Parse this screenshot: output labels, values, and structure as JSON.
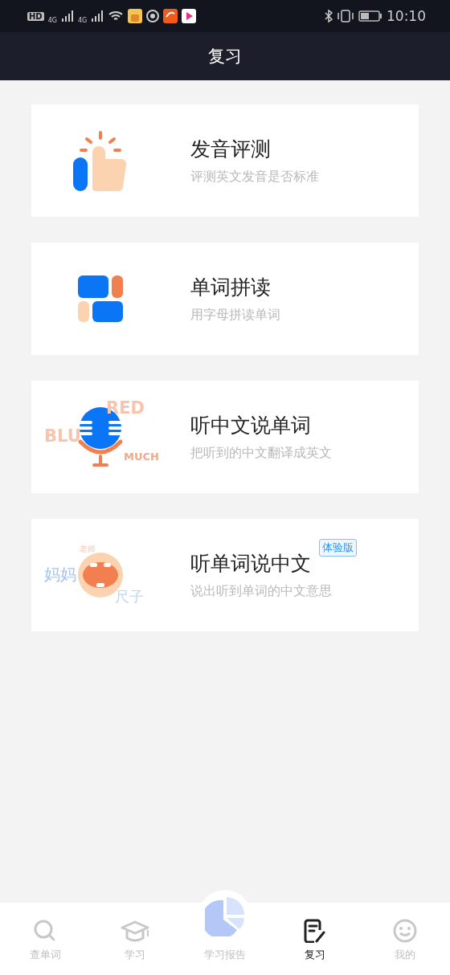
{
  "status_bar": {
    "network_labels": [
      "HD",
      "4G",
      "4G"
    ],
    "time": "10:10"
  },
  "header": {
    "title": "复习"
  },
  "cards": [
    {
      "title": "发音评测",
      "subtitle": "评测英文发音是否标准",
      "kind": "hand"
    },
    {
      "title": "单词拼读",
      "subtitle": "用字母拼读单词",
      "kind": "blocks"
    },
    {
      "title": "听中文说单词",
      "subtitle": "把听到的中文翻译成英文",
      "kind": "mic",
      "words": [
        "RED",
        "BLU",
        "MUCH"
      ]
    },
    {
      "title": "听单词说中文",
      "subtitle": "说出听到单词的中文意思",
      "badge": "体验版",
      "kind": "mouth",
      "words": [
        "老师",
        "妈妈",
        "尺子"
      ]
    }
  ],
  "nav": [
    {
      "label": "查单词",
      "kind": "search",
      "selected": false
    },
    {
      "label": "学习",
      "kind": "cap",
      "selected": false
    },
    {
      "label": "学习报告",
      "kind": "pie",
      "selected": false
    },
    {
      "label": "复习",
      "kind": "note",
      "selected": true
    },
    {
      "label": "我的",
      "kind": "smile",
      "selected": false
    }
  ]
}
